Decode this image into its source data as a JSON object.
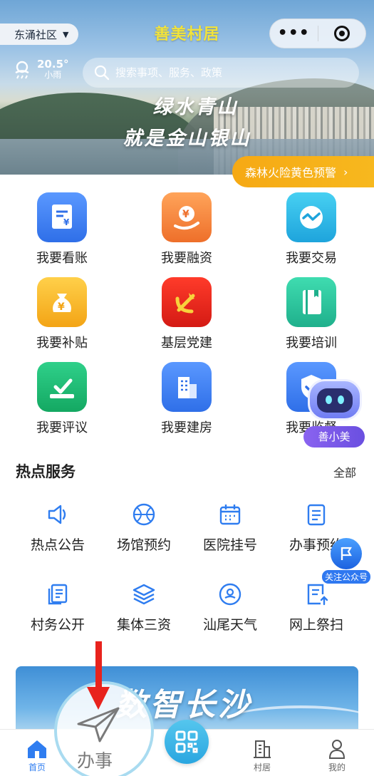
{
  "header": {
    "community": "东涌社区",
    "caret": "▼",
    "app_title": "善美村居",
    "menu_more": "•••"
  },
  "weather": {
    "temperature": "20.5°",
    "condition": "小雨"
  },
  "search": {
    "placeholder": "搜索事项、服务、政策"
  },
  "banner": {
    "slogan_line1": "绿水青山",
    "slogan_line2": "就是金山银山",
    "warning": "森林火险黄色预警",
    "warning_chevron": "›"
  },
  "quick_grid": [
    {
      "label": "我要看账",
      "icon": "bill-icon",
      "color": "#3b7ef2"
    },
    {
      "label": "我要融资",
      "icon": "money-hand-icon",
      "color": "#f0843a"
    },
    {
      "label": "我要交易",
      "icon": "exchange-icon",
      "color": "#27b6e4"
    },
    {
      "label": "我要补贴",
      "icon": "money-bag-icon",
      "color": "#f5b526"
    },
    {
      "label": "基层党建",
      "icon": "party-emblem-icon",
      "color": "#e52b20"
    },
    {
      "label": "我要培训",
      "icon": "book-icon",
      "color": "#26bf9a"
    },
    {
      "label": "我要评议",
      "icon": "vote-check-icon",
      "color": "#21b46e"
    },
    {
      "label": "我要建房",
      "icon": "building-icon",
      "color": "#3b7ef2"
    },
    {
      "label": "我要监督",
      "icon": "shield-icon",
      "color": "#3b7ef2"
    }
  ],
  "assistant": {
    "name": "善小美"
  },
  "hot_services": {
    "title": "热点服务",
    "more": "全部",
    "items": [
      {
        "label": "热点公告",
        "icon": "speaker-icon"
      },
      {
        "label": "场馆预约",
        "icon": "basketball-icon"
      },
      {
        "label": "医院挂号",
        "icon": "calendar-icon"
      },
      {
        "label": "办事预约",
        "icon": "clipboard-icon"
      },
      {
        "label": "村务公开",
        "icon": "documents-icon"
      },
      {
        "label": "集体三资",
        "icon": "layers-icon"
      },
      {
        "label": "汕尾天气",
        "icon": "weather-icon"
      },
      {
        "label": "网上祭扫",
        "icon": "upload-doc-icon"
      }
    ]
  },
  "follow": {
    "label": "关注公众号"
  },
  "promo": {
    "title": "数智长沙"
  },
  "tabbar": {
    "items": [
      {
        "label": "首页",
        "icon": "home-icon",
        "active": true
      },
      {
        "label": "",
        "icon": "location-arrow-icon"
      },
      {
        "label": "",
        "icon": "qr-scan-icon"
      },
      {
        "label": "村居",
        "icon": "village-icon"
      },
      {
        "label": "我的",
        "icon": "user-icon"
      }
    ]
  },
  "overlay": {
    "label": "办事"
  },
  "colors": {
    "accent_blue": "#2f7df0",
    "title_yellow": "#f2e33b",
    "warning_orange": "#f6a914",
    "arrow_red": "#e8231d"
  }
}
